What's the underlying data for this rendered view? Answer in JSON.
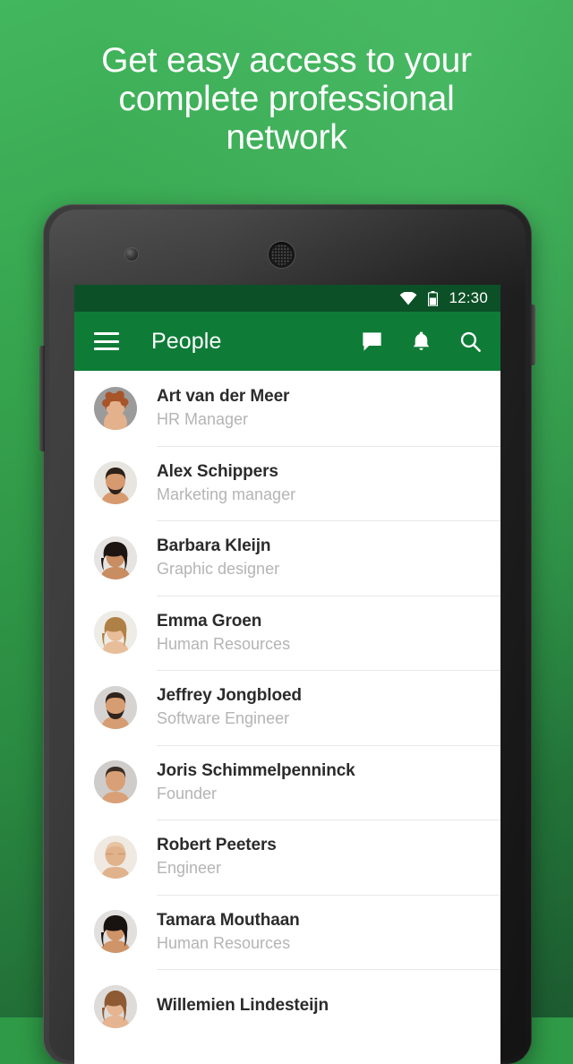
{
  "promo": {
    "headline": "Get easy access to your complete professional network",
    "background_top_color": "#43b75e",
    "background_bottom_color": "#1c5b30"
  },
  "phone": {
    "statusbar": {
      "time": "12:30",
      "wifi_icon": "wifi-icon",
      "battery_icon": "battery-icon",
      "background_color": "#0c5027"
    },
    "appbar": {
      "menu_icon": "hamburger-menu-icon",
      "title": "People",
      "background_color": "#0e7c37",
      "actions": [
        {
          "icon": "chat-bubble-icon",
          "label": "Messages"
        },
        {
          "icon": "bell-icon",
          "label": "Notifications"
        },
        {
          "icon": "search-icon",
          "label": "Search"
        }
      ]
    },
    "people": [
      {
        "name": "Art van der Meer",
        "role": "HR Manager",
        "avatar": "avatar-curly-hair-woman",
        "skin": "#e3b18c",
        "hair": "#a8552a",
        "bg": "#9b9b9b"
      },
      {
        "name": "Alex Schippers",
        "role": "Marketing manager",
        "avatar": "avatar-bearded-man",
        "skin": "#d79a6f",
        "hair": "#2e2119",
        "bg": "#e7e5e0"
      },
      {
        "name": "Barbara Kleijn",
        "role": "Graphic designer",
        "avatar": "avatar-dark-hair-woman",
        "skin": "#c98d62",
        "hair": "#1d1512",
        "bg": "#e6e4e2"
      },
      {
        "name": "Emma Groen",
        "role": "Human Resources",
        "avatar": "avatar-blonde-woman",
        "skin": "#e8bd99",
        "hair": "#b08147",
        "bg": "#eeece7"
      },
      {
        "name": "Jeffrey Jongbloed",
        "role": "Software Engineer",
        "avatar": "avatar-beard-man",
        "skin": "#d69d72",
        "hair": "#30241c",
        "bg": "#d6d4d2"
      },
      {
        "name": "Joris Schimmelpenninck",
        "role": "Founder",
        "avatar": "avatar-short-hair-man",
        "skin": "#d9a077",
        "hair": "#3a2e24",
        "bg": "#cfcdcb"
      },
      {
        "name": "Robert Peeters",
        "role": "Engineer",
        "avatar": "avatar-bald-man",
        "skin": "#e0b38d",
        "hair": "#cfc6bd",
        "bg": "#efe9e2"
      },
      {
        "name": "Tamara Mouthaan",
        "role": "Human Resources",
        "avatar": "avatar-long-hair-woman",
        "skin": "#cf9468",
        "hair": "#181210",
        "bg": "#e2e0de"
      },
      {
        "name": "Willemien Lindesteijn",
        "role": "",
        "avatar": "avatar-wavy-hair-woman",
        "skin": "#e5b491",
        "hair": "#8d5a33",
        "bg": "#dedcda"
      }
    ]
  }
}
